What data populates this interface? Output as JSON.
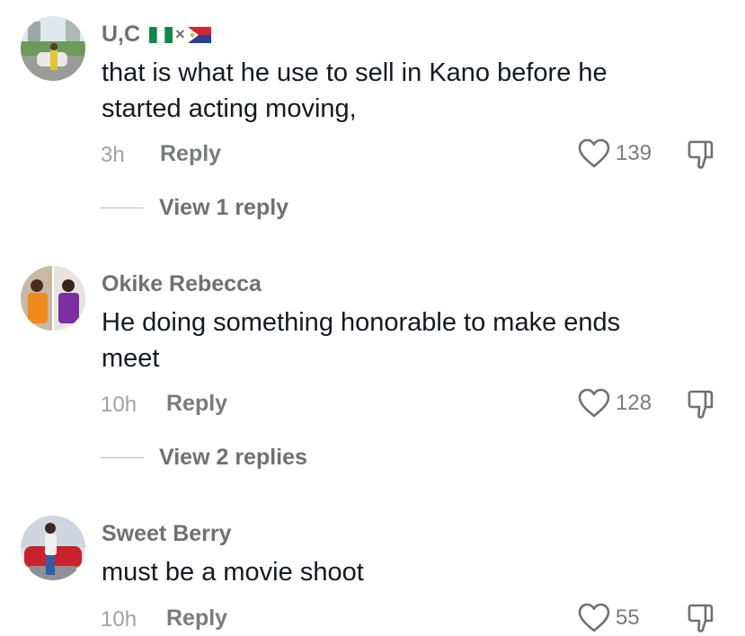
{
  "comments": [
    {
      "username": "U,C",
      "flags": [
        "nigeria-flag",
        "sint-maarten-flag"
      ],
      "flag_separator": "×",
      "text": "that is what he use to sell in Kano before he started acting moving,",
      "time": "3h",
      "reply_label": "Reply",
      "likes": "139",
      "view_replies": "View 1 reply"
    },
    {
      "username": "Okike Rebecca",
      "text": "He doing something honorable to make ends meet",
      "time": "10h",
      "reply_label": "Reply",
      "likes": "128",
      "view_replies": "View 2 replies"
    },
    {
      "username": "Sweet Berry",
      "text": "must be a movie shoot",
      "time": "10h",
      "reply_label": "Reply",
      "likes": "55"
    }
  ],
  "icons": {
    "like": "heart-outline-icon",
    "dislike": "thumbs-down-icon"
  },
  "colors": {
    "text": "#161823",
    "muted": "#a0a1a5",
    "username": "#6f7075"
  }
}
